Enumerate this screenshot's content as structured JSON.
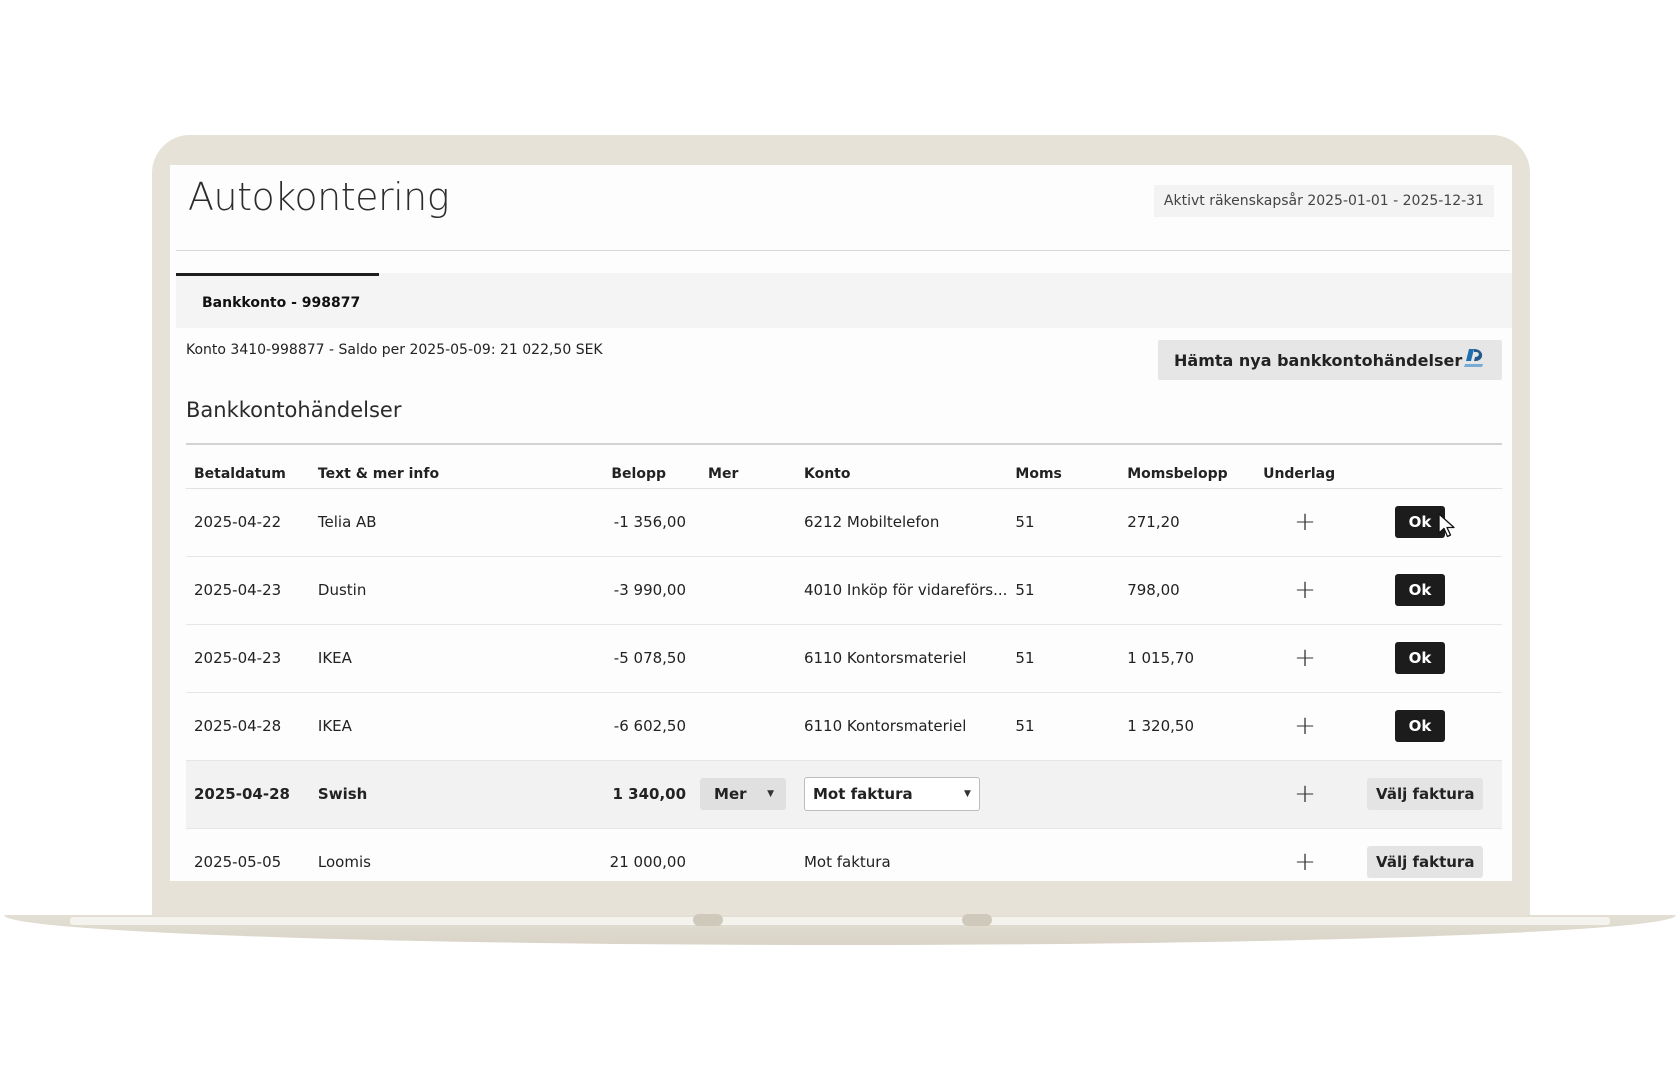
{
  "page": {
    "title": "Autokontering",
    "fiscal_year": "Aktivt räkenskapsår 2025-01-01 - 2025-12-31"
  },
  "tabs": [
    {
      "label": "Bankkonto - 998877",
      "active": true
    }
  ],
  "account": {
    "info": "Konto 3410-998877 - Saldo per 2025-05-09: 21 022,50 SEK",
    "fetch_button": "Hämta nya bankkontohändelser",
    "fetch_icon": "bankid-icon"
  },
  "section": {
    "title": "Bankkontohändelser"
  },
  "table": {
    "headers": [
      "Betaldatum",
      "Text & mer info",
      "Belopp",
      "Mer",
      "Konto",
      "Moms",
      "Momsbelopp",
      "Underlag",
      ""
    ],
    "rows": [
      {
        "date": "2025-04-22",
        "text": "Telia AB",
        "amount": "-1 356,00",
        "mer": "",
        "konto": "6212 Mobiltelefon",
        "moms": "51",
        "momsbelopp": "271,20",
        "action": "Ok"
      },
      {
        "date": "2025-04-23",
        "text": "Dustin",
        "amount": "-3 990,00",
        "mer": "",
        "konto": "4010 Inköp för vidareförs...",
        "moms": "51",
        "momsbelopp": "798,00",
        "action": "Ok"
      },
      {
        "date": "2025-04-23",
        "text": "IKEA",
        "amount": "-5 078,50",
        "mer": "",
        "konto": "6110 Kontorsmateriel",
        "moms": "51",
        "momsbelopp": "1 015,70",
        "action": "Ok"
      },
      {
        "date": "2025-04-28",
        "text": "IKEA",
        "amount": "-6 602,50",
        "mer": "",
        "konto": "6110 Kontorsmateriel",
        "moms": "51",
        "momsbelopp": "1 320,50",
        "action": "Ok"
      },
      {
        "date": "2025-04-28",
        "text": "Swish",
        "amount": "1 340,00",
        "mer": "Mer",
        "konto": "Mot faktura",
        "moms": "",
        "momsbelopp": "",
        "action": "Välj faktura"
      },
      {
        "date": "2025-05-05",
        "text": "Loomis",
        "amount": "21 000,00",
        "mer": "",
        "konto": "Mot faktura",
        "moms": "",
        "momsbelopp": "",
        "action": "Välj faktura"
      }
    ]
  },
  "colors": {
    "laptop_frame": "#e6e2d8",
    "dark_button": "#1c1c1c",
    "light_button": "#e4e4e4"
  }
}
